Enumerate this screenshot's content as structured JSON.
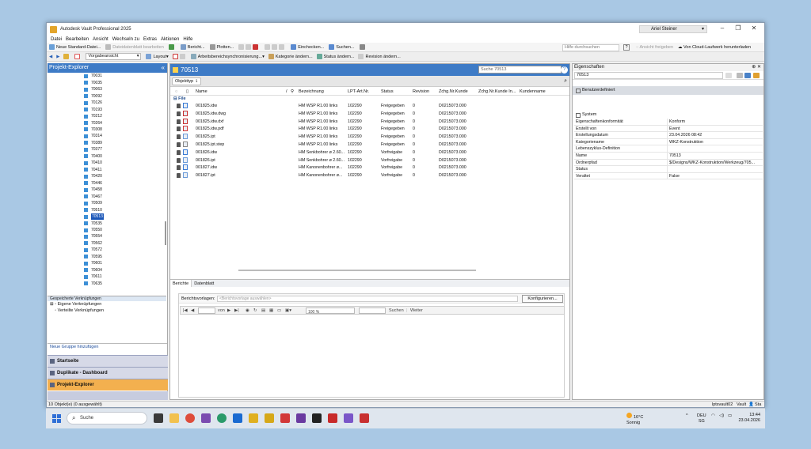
{
  "window": {
    "title": "Autodesk Vault Professional 2025",
    "user": "Ariel Steiner"
  },
  "menu": [
    "Datei",
    "Bearbeiten",
    "Ansicht",
    "Wechseln zu",
    "Extras",
    "Aktionen",
    "Hilfe"
  ],
  "toolbar1": {
    "new_file": "Neue Standard-Datei...",
    "edit_datasheet": "Dateidatenblatt bearbeiten",
    "report": "Bericht...",
    "plot": "Plotten...",
    "checkin": "Einchecken...",
    "search": "Suchen...",
    "help_search": "Hilfe durchsuchen",
    "share_view": "Ansicht freigeben",
    "cloud_download": "Von Cloud-Laufwerk herunterladen"
  },
  "toolbar2": {
    "view_select": "Vorgabeansicht",
    "layout": "Layout",
    "sync": "Arbeitsbereichsynchronisierung...",
    "change_category": "Kategorie ändern...",
    "change_status": "Status ändern...",
    "change_revision": "Revision ändern..."
  },
  "left_panel": {
    "title": "Projekt-Explorer",
    "folders": [
      "70031",
      "70035",
      "70063",
      "70092",
      "70126",
      "70193",
      "70212",
      "70264",
      "70308",
      "70314",
      "70389",
      "70377",
      "70400",
      "70410",
      "70411",
      "70420",
      "70446",
      "70458",
      "70467",
      "70509",
      "70510",
      "70513",
      "70535",
      "70550",
      "70554",
      "70562",
      "70572",
      "70595",
      "70601",
      "70604",
      "70611",
      "70635"
    ],
    "selected_folder": "70513",
    "saved_links_title": "Gespeicherte Verknüpfungen",
    "own_links": "Eigene Verknüpfungen",
    "distributed_links": "Verteilte Verknüpfungen",
    "new_group": "Neue Gruppe hinzufügen",
    "nav_home": "Startseite",
    "nav_duplicates": "Duplikate - Dashboard",
    "nav_explorer": "Projekt-Explorer"
  },
  "center": {
    "title": "70513",
    "search_placeholder": "Suche 70513",
    "group_pill": "Objekttyp",
    "columns": {
      "name": "Name",
      "bez": "Bezeichnung",
      "lpt": "LPT-Art.Nr.",
      "status": "Status",
      "rev": "Revision",
      "zchg": "Zchg.Nr.Kunde",
      "zchg2": "Zchg.Nr.Kunde In...",
      "kunde": "Kundenname"
    },
    "group": "File",
    "files": [
      {
        "name": "001825.idw",
        "bez": "HM WSP R1.00 links",
        "lpt": "102290",
        "status": "Freigegeben",
        "rev": "0",
        "zchg": "D0215073.000",
        "icon": "idw"
      },
      {
        "name": "001825.idw.dwg",
        "bez": "HM WSP R1.00 links",
        "lpt": "102290",
        "status": "Freigegeben",
        "rev": "0",
        "zchg": "D0215073.000",
        "icon": "dwg"
      },
      {
        "name": "001825.idw.dxf",
        "bez": "HM WSP R1.00 links",
        "lpt": "102290",
        "status": "Freigegeben",
        "rev": "0",
        "zchg": "D0215073.000",
        "icon": "dxf"
      },
      {
        "name": "001825.idw.pdf",
        "bez": "HM WSP R1.00 links",
        "lpt": "102290",
        "status": "Freigegeben",
        "rev": "0",
        "zchg": "D0215073.000",
        "icon": "pdf"
      },
      {
        "name": "001825.ipt",
        "bez": "HM WSP R1.00 links",
        "lpt": "102290",
        "status": "Freigegeben",
        "rev": "0",
        "zchg": "D0215073.000",
        "icon": "ipt"
      },
      {
        "name": "001825.ipt.step",
        "bez": "HM WSP R1.00 links",
        "lpt": "102290",
        "status": "Freigegeben",
        "rev": "0",
        "zchg": "D0215073.000",
        "icon": "step"
      },
      {
        "name": "001826.idw",
        "bez": "HM Senkbohrer ø 2.60...",
        "lpt": "102290",
        "status": "Vorfreigabe",
        "rev": "0",
        "zchg": "D0215073.000",
        "icon": "idw"
      },
      {
        "name": "001826.ipt",
        "bez": "HM Senkbohrer ø 2.60...",
        "lpt": "102290",
        "status": "Vorfreigabe",
        "rev": "0",
        "zchg": "D0215073.000",
        "icon": "ipt"
      },
      {
        "name": "001827.idw",
        "bez": "HM Kanonenbohrer ø...",
        "lpt": "102290",
        "status": "Vorfreigabe",
        "rev": "0",
        "zchg": "D0215073.000",
        "icon": "idw"
      },
      {
        "name": "001827.ipt",
        "bez": "HM Kanonenbohrer ø...",
        "lpt": "102290",
        "status": "Vorfreigabe",
        "rev": "0",
        "zchg": "D0215073.000",
        "icon": "ipt"
      }
    ],
    "tab_reports": "Berichte",
    "tab_datasheet": "Datenblatt",
    "report_label": "Berichtsvorlagen:",
    "report_placeholder": "<Berichtsvorlage auswählen>",
    "configure": "Konfigurieren...",
    "page_of": "von",
    "zoom": "100 %",
    "find": "Suchen",
    "next": "Weiter"
  },
  "right_panel": {
    "title": "Eigenschaften",
    "value": "70513",
    "section": "Benutzerdefiniert",
    "system": "System",
    "props": [
      {
        "k": "Eigenschaftenkonformität",
        "v": "Konform"
      },
      {
        "k": "Erstellt von",
        "v": "Event"
      },
      {
        "k": "Erstellungsdatum",
        "v": "23.04.2026 08:42"
      },
      {
        "k": "Kategoriename",
        "v": "WKZ-Konstruktion"
      },
      {
        "k": "Lebenszyklus-Definition",
        "v": ""
      },
      {
        "k": "Name",
        "v": "70513"
      },
      {
        "k": "Ordnerpfad",
        "v": "$/Designs/WKZ-Konstruktion/Werkzeug/705..."
      },
      {
        "k": "Status",
        "v": ""
      },
      {
        "k": "Veraltet",
        "v": "False"
      }
    ]
  },
  "statusbar": {
    "left": "10 Objekt(e) (0 ausgewählt)",
    "server": "lptsvault02",
    "vault": "Vault",
    "sta": "Sta"
  },
  "taskbar": {
    "search": "Suche",
    "weather_temp": "16°C",
    "weather_text": "Sonnig",
    "lang": "DEU",
    "lang2": "SG",
    "time": "13:44",
    "date": "23.04.2026"
  }
}
